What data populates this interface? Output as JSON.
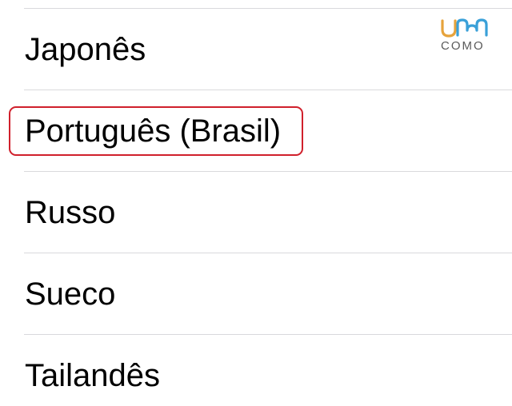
{
  "languages": [
    {
      "label": "Japonês"
    },
    {
      "label": "Português (Brasil)"
    },
    {
      "label": "Russo"
    },
    {
      "label": "Sueco"
    },
    {
      "label": "Tailandês"
    }
  ],
  "highlight": {
    "target": "Português (Brasil)",
    "color": "#d0202c"
  },
  "watermark": {
    "text": "COMO",
    "logo": "um-como-logo",
    "colors": {
      "orange": "#e6a33c",
      "blue": "#3aa0d8",
      "gray": "#5a5a5a"
    }
  },
  "colors": {
    "separator": "#d9d9dc",
    "text": "#000000",
    "background": "#ffffff"
  }
}
